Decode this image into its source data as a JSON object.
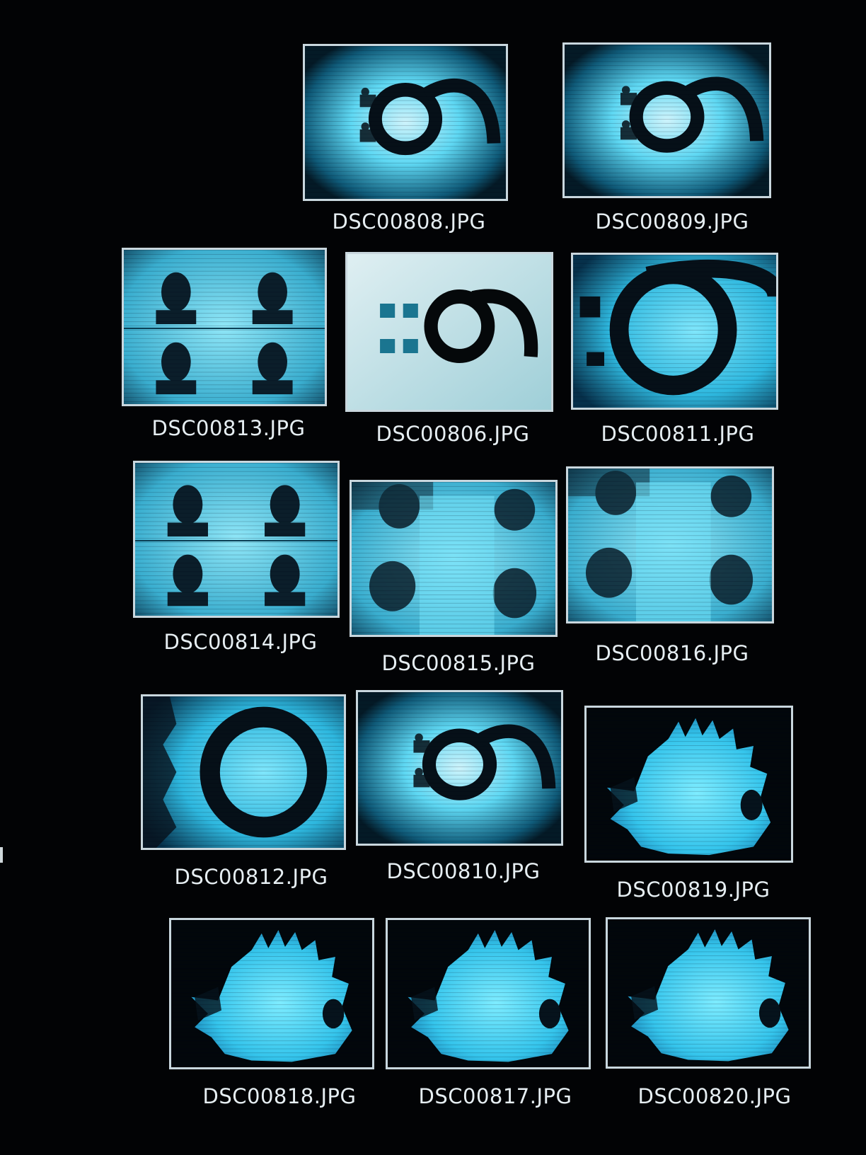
{
  "file_browser": {
    "files": [
      {
        "name": "DSC00808.JPG",
        "content": "nine-logo-faces"
      },
      {
        "name": "DSC00809.JPG",
        "content": "nine-logo-faces"
      },
      {
        "name": "DSC00813.JPG",
        "content": "four-faces"
      },
      {
        "name": "DSC00806.JPG",
        "content": "nine-logo-print"
      },
      {
        "name": "DSC00811.JPG",
        "content": "nine-logo-closeup"
      },
      {
        "name": "DSC00814.JPG",
        "content": "four-faces"
      },
      {
        "name": "DSC00815.JPG",
        "content": "faces-blurred"
      },
      {
        "name": "DSC00816.JPG",
        "content": "faces-blurred"
      },
      {
        "name": "DSC00812.JPG",
        "content": "ring-closeup"
      },
      {
        "name": "DSC00810.JPG",
        "content": "nine-logo-faces"
      },
      {
        "name": "DSC00819.JPG",
        "content": "spiky-silhouette"
      },
      {
        "name": "DSC00818.JPG",
        "content": "spiky-silhouette"
      },
      {
        "name": "DSC00817.JPG",
        "content": "spiky-silhouette"
      },
      {
        "name": "DSC00820.JPG",
        "content": "spiky-silhouette"
      }
    ]
  },
  "colors": {
    "background": "#020305",
    "thumbnail_border": "#c9d7de",
    "label_text": "#e6eef2",
    "cyan_glow": "#47d6f5"
  }
}
